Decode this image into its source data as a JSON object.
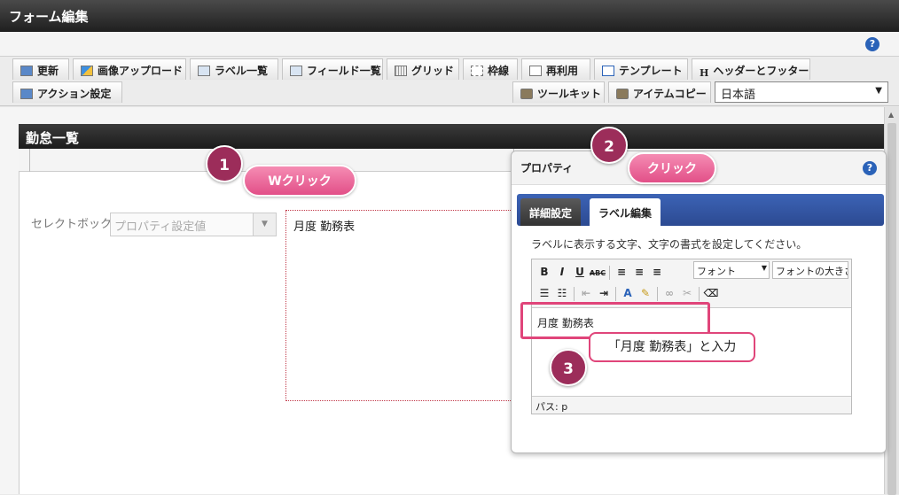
{
  "app": {
    "title": "フォーム編集"
  },
  "toolbar": {
    "row1": [
      {
        "label": "更新",
        "icon": "refresh-icon"
      },
      {
        "label": "画像アップロード",
        "icon": "image-upload-icon"
      },
      {
        "label": "ラベル一覧",
        "icon": "label-list-icon"
      },
      {
        "label": "フィールド一覧",
        "icon": "field-list-icon"
      },
      {
        "label": "グリッド",
        "icon": "grid-icon"
      },
      {
        "label": "枠線",
        "icon": "border-icon"
      },
      {
        "label": "再利用",
        "icon": "reuse-icon"
      },
      {
        "label": "テンプレート",
        "icon": "template-icon"
      },
      {
        "label": "ヘッダーとフッター",
        "icon": "header-footer-icon"
      }
    ],
    "row2": [
      {
        "label": "アクション設定",
        "icon": "action-icon"
      },
      {
        "label": "ツールキット",
        "icon": "toolkit-icon"
      },
      {
        "label": "アイテムコピー",
        "icon": "item-copy-icon"
      }
    ],
    "language": "日本語"
  },
  "panel": {
    "title": "勤怠一覧"
  },
  "form": {
    "select_label": "セレクトボックス",
    "select_value": "プロパティ設定値",
    "label_text": "月度 勤務表"
  },
  "dialog": {
    "title": "プロパティ",
    "tabs": [
      "詳細設定",
      "ラベル編集"
    ],
    "description": "ラベルに表示する文字、文字の書式を設定してください。",
    "font_select": "フォント",
    "font_size_select": "フォントの大きさ",
    "editor_text": "月度 勤務表",
    "path": "パス: p"
  },
  "annotations": {
    "step1": {
      "number": "1",
      "text": "Wクリック"
    },
    "step2": {
      "number": "2",
      "text": "クリック"
    },
    "step3": {
      "number": "3",
      "text": "「月度 勤務表」と入力"
    }
  },
  "colors": {
    "accent_pink": "#e24f88",
    "marker": "#9c2d5a",
    "tab_blue": "#3c63b5"
  }
}
